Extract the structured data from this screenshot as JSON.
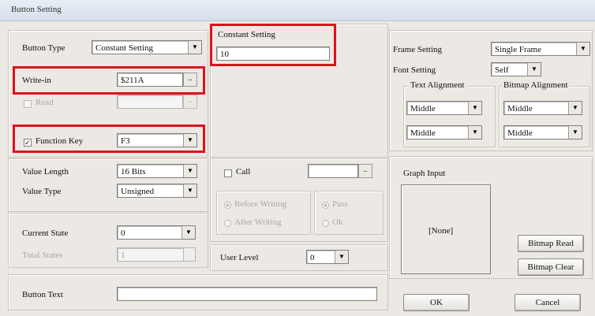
{
  "window": {
    "title": "Button Setting"
  },
  "button_type": {
    "label": "Button Type",
    "value": "Constant Setting"
  },
  "write_in": {
    "label": "Write-in",
    "value": "$211A"
  },
  "read": {
    "label": "Read",
    "value": ""
  },
  "function_key": {
    "label": "Function Key",
    "value": "F3",
    "checked": true
  },
  "constant_setting": {
    "label": "Constant Setting",
    "value": "10"
  },
  "value_length": {
    "label": "Value Length",
    "value": "16 Bits"
  },
  "value_type": {
    "label": "Value Type",
    "value": "Unsigned"
  },
  "current_state": {
    "label": "Current State",
    "value": "0"
  },
  "state_count": {
    "label": "Total States",
    "value": "1"
  },
  "call": {
    "label": "Call",
    "value": ""
  },
  "write_timing": {
    "option1": "Before Writing",
    "option2": "After Writing"
  },
  "ok_ng": {
    "option1": "Pass",
    "option2": "Ok"
  },
  "user_level": {
    "label": "User Level",
    "value": "0"
  },
  "button_text": {
    "label": "Button Text",
    "value": ""
  },
  "frame_setting": {
    "label": "Frame Setting",
    "value": "Single Frame"
  },
  "font_setting": {
    "label": "Font Setting",
    "value": "Self"
  },
  "text_alignment": {
    "label": "Text Alignment",
    "horizontal": "Middle",
    "vertical": "Middle"
  },
  "bitmap_alignment": {
    "label": "Bitmap Alignment",
    "horizontal": "Middle",
    "vertical": "Middle"
  },
  "graph_input": {
    "label": "Graph Input",
    "preview_text": "[None]"
  },
  "buttons": {
    "bitmap_read": "Bitmap Read",
    "bitmap_clear": "Bitmap Clear",
    "ok": "OK",
    "cancel": "Cancel"
  }
}
